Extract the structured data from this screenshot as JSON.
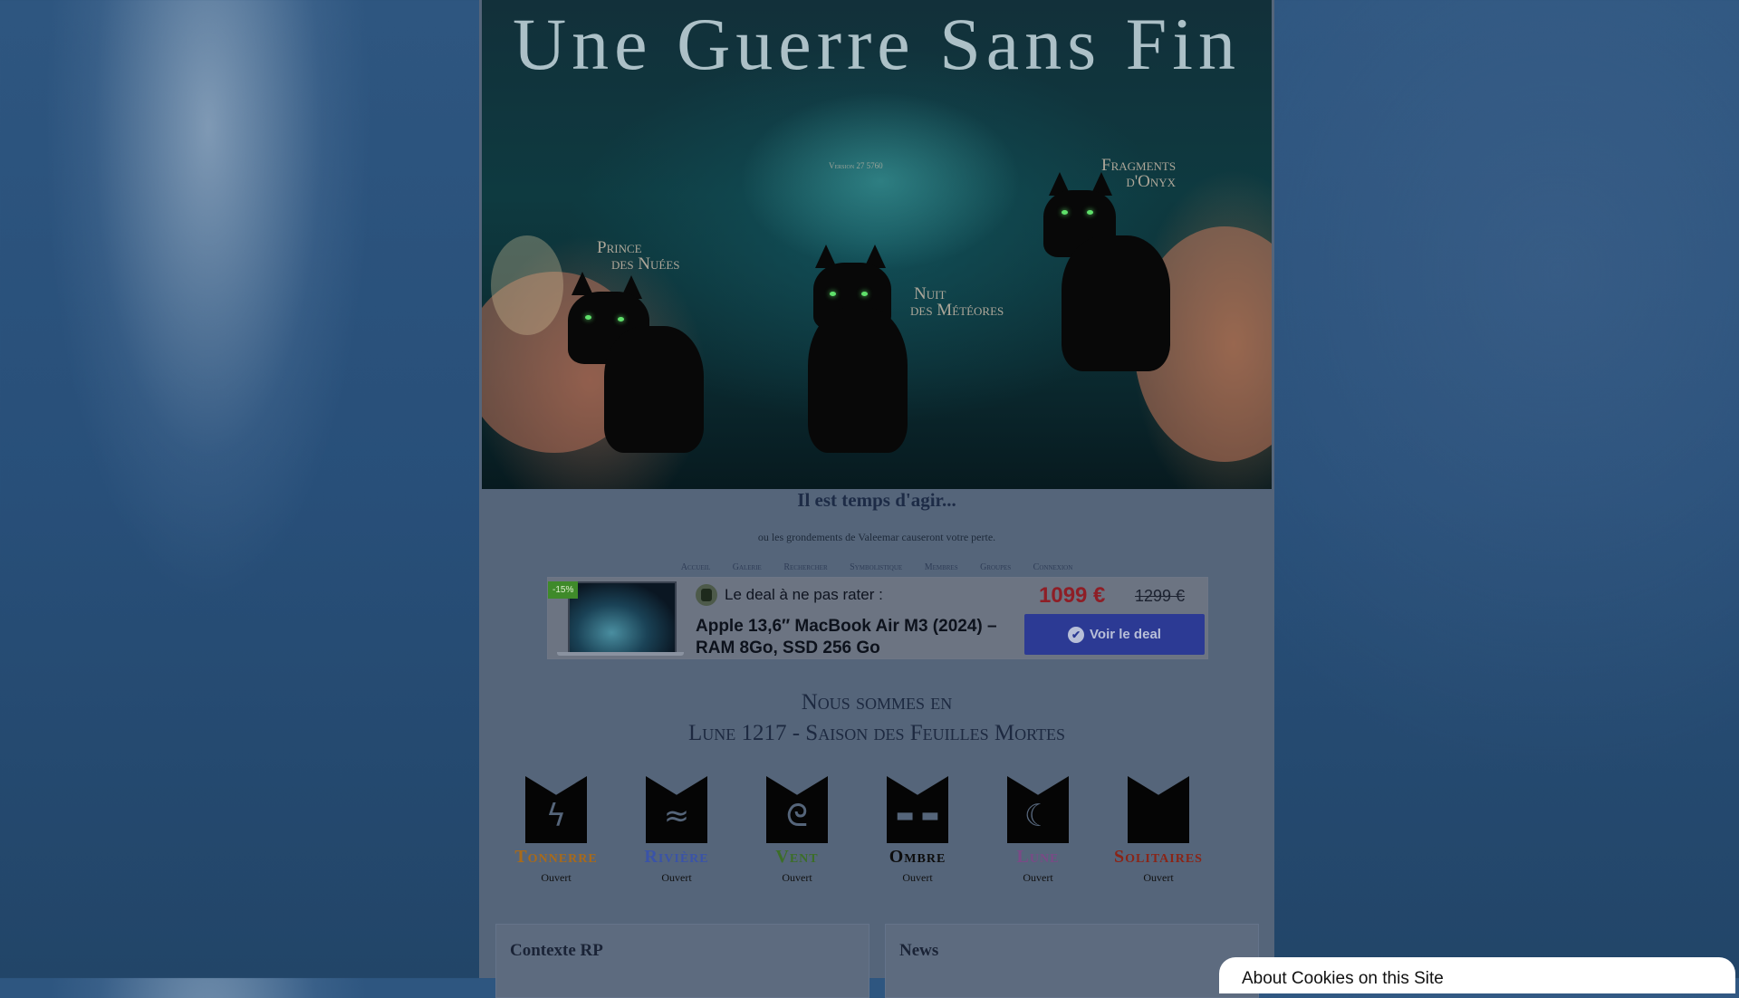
{
  "banner": {
    "title": "Une Guerre Sans Fin",
    "version_label": "Version 27 5760",
    "labels": [
      {
        "line1": "Prince",
        "line2": "des Nuées"
      },
      {
        "line1": "Nuit",
        "line2": "des Météores"
      },
      {
        "line1": "Fragments",
        "line2": "d'Onyx"
      }
    ]
  },
  "headline": "Il est temps d'agir...",
  "subline": "ou les grondements de Valeemar causeront votre perte.",
  "nav": [
    "Accueil",
    "Galerie",
    "Rechercher",
    "Symbolistique",
    "Membres",
    "Groupes",
    "Connexion"
  ],
  "deal": {
    "badge": "-15%",
    "header": "Le deal à ne pas rater :",
    "product": "Apple 13,6″ MacBook Air M3 (2024) – RAM 8Go, SSD 256 Go",
    "price": "1099 €",
    "old_price": "1299 €",
    "button": "Voir le deal"
  },
  "date": {
    "line1": "Nous sommes en",
    "line2": "Lune 1217 - Saison des Feuilles Mortes"
  },
  "clans": [
    {
      "name": "Tonnerre",
      "state": "Ouvert",
      "color": "#a86a1a",
      "icon": "lightning-icon"
    },
    {
      "name": "Rivière",
      "state": "Ouvert",
      "color": "#3a53a8",
      "icon": "waves-icon"
    },
    {
      "name": "Vent",
      "state": "Ouvert",
      "color": "#3c6e28",
      "icon": "swirl-icon"
    },
    {
      "name": "Ombre",
      "state": "Ouvert",
      "color": "#0c0c0c",
      "icon": "eyes-icon"
    },
    {
      "name": "Lune",
      "state": "Ouvert",
      "color": "#7a4a86",
      "icon": "crescent-icon"
    },
    {
      "name": "Solitaires",
      "state": "Ouvert",
      "color": "#8a2416",
      "icon": "plain-cat-icon"
    }
  ],
  "panels": {
    "left_title": "Contexte RP",
    "right_title": "News"
  },
  "cookie": {
    "text": "About Cookies on this Site"
  }
}
